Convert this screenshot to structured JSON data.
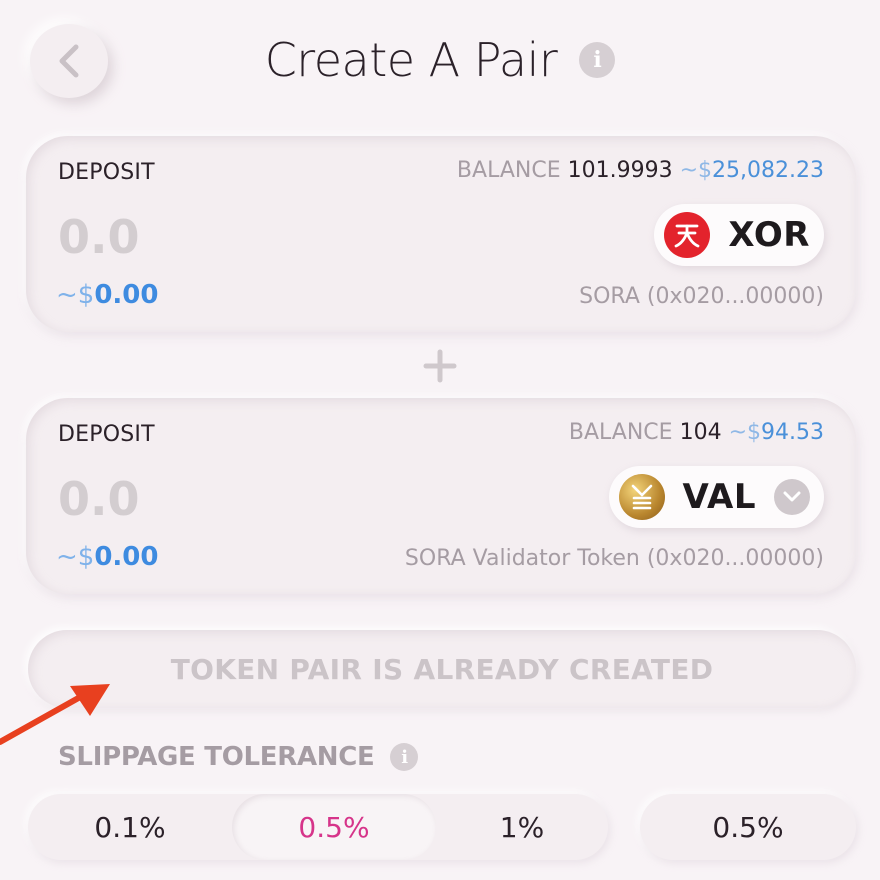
{
  "header": {
    "title": "Create A Pair",
    "info_glyph": "i"
  },
  "cards": [
    {
      "label": "DEPOSIT",
      "balance_label": "BALANCE",
      "balance_value": "101.9993",
      "balance_fiat_prefix": "~$",
      "balance_fiat": "25,082.23",
      "amount": "0.0",
      "fiat_prefix": "~$",
      "fiat": "0.00",
      "token_symbol": "XOR",
      "token_name": "SORA (0x020...00000)",
      "token_icon": "xor-logo-icon"
    },
    {
      "label": "DEPOSIT",
      "balance_label": "BALANCE",
      "balance_value": "104",
      "balance_fiat_prefix": "~$",
      "balance_fiat": "94.53",
      "amount": "0.0",
      "fiat_prefix": "~$",
      "fiat": "0.00",
      "token_symbol": "VAL",
      "token_name": "SORA Validator Token (0x020...00000)",
      "token_icon": "val-logo-icon"
    }
  ],
  "status_button": "TOKEN PAIR IS ALREADY CREATED",
  "slippage": {
    "label": "SLIPPAGE TOLERANCE",
    "options": [
      "0.1%",
      "0.5%",
      "1%"
    ],
    "selected": "0.5%",
    "custom_value": "0.5%"
  },
  "colors": {
    "background": "#f8f3f6",
    "accent_blue": "#3e8be0",
    "accent_pink": "#d6348a",
    "annotation_arrow": "#e8401f"
  }
}
